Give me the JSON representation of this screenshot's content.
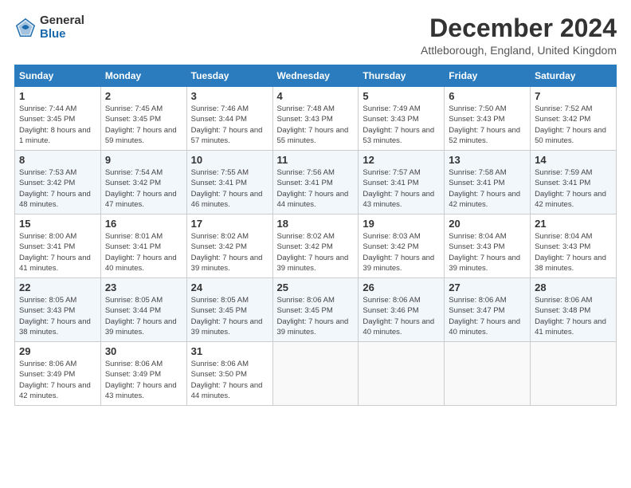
{
  "logo": {
    "general": "General",
    "blue": "Blue"
  },
  "header": {
    "month": "December 2024",
    "location": "Attleborough, England, United Kingdom"
  },
  "weekdays": [
    "Sunday",
    "Monday",
    "Tuesday",
    "Wednesday",
    "Thursday",
    "Friday",
    "Saturday"
  ],
  "weeks": [
    [
      {
        "day": "1",
        "sunrise": "Sunrise: 7:44 AM",
        "sunset": "Sunset: 3:45 PM",
        "daylight": "Daylight: 8 hours and 1 minute."
      },
      {
        "day": "2",
        "sunrise": "Sunrise: 7:45 AM",
        "sunset": "Sunset: 3:45 PM",
        "daylight": "Daylight: 7 hours and 59 minutes."
      },
      {
        "day": "3",
        "sunrise": "Sunrise: 7:46 AM",
        "sunset": "Sunset: 3:44 PM",
        "daylight": "Daylight: 7 hours and 57 minutes."
      },
      {
        "day": "4",
        "sunrise": "Sunrise: 7:48 AM",
        "sunset": "Sunset: 3:43 PM",
        "daylight": "Daylight: 7 hours and 55 minutes."
      },
      {
        "day": "5",
        "sunrise": "Sunrise: 7:49 AM",
        "sunset": "Sunset: 3:43 PM",
        "daylight": "Daylight: 7 hours and 53 minutes."
      },
      {
        "day": "6",
        "sunrise": "Sunrise: 7:50 AM",
        "sunset": "Sunset: 3:43 PM",
        "daylight": "Daylight: 7 hours and 52 minutes."
      },
      {
        "day": "7",
        "sunrise": "Sunrise: 7:52 AM",
        "sunset": "Sunset: 3:42 PM",
        "daylight": "Daylight: 7 hours and 50 minutes."
      }
    ],
    [
      {
        "day": "8",
        "sunrise": "Sunrise: 7:53 AM",
        "sunset": "Sunset: 3:42 PM",
        "daylight": "Daylight: 7 hours and 48 minutes."
      },
      {
        "day": "9",
        "sunrise": "Sunrise: 7:54 AM",
        "sunset": "Sunset: 3:42 PM",
        "daylight": "Daylight: 7 hours and 47 minutes."
      },
      {
        "day": "10",
        "sunrise": "Sunrise: 7:55 AM",
        "sunset": "Sunset: 3:41 PM",
        "daylight": "Daylight: 7 hours and 46 minutes."
      },
      {
        "day": "11",
        "sunrise": "Sunrise: 7:56 AM",
        "sunset": "Sunset: 3:41 PM",
        "daylight": "Daylight: 7 hours and 44 minutes."
      },
      {
        "day": "12",
        "sunrise": "Sunrise: 7:57 AM",
        "sunset": "Sunset: 3:41 PM",
        "daylight": "Daylight: 7 hours and 43 minutes."
      },
      {
        "day": "13",
        "sunrise": "Sunrise: 7:58 AM",
        "sunset": "Sunset: 3:41 PM",
        "daylight": "Daylight: 7 hours and 42 minutes."
      },
      {
        "day": "14",
        "sunrise": "Sunrise: 7:59 AM",
        "sunset": "Sunset: 3:41 PM",
        "daylight": "Daylight: 7 hours and 42 minutes."
      }
    ],
    [
      {
        "day": "15",
        "sunrise": "Sunrise: 8:00 AM",
        "sunset": "Sunset: 3:41 PM",
        "daylight": "Daylight: 7 hours and 41 minutes."
      },
      {
        "day": "16",
        "sunrise": "Sunrise: 8:01 AM",
        "sunset": "Sunset: 3:41 PM",
        "daylight": "Daylight: 7 hours and 40 minutes."
      },
      {
        "day": "17",
        "sunrise": "Sunrise: 8:02 AM",
        "sunset": "Sunset: 3:42 PM",
        "daylight": "Daylight: 7 hours and 39 minutes."
      },
      {
        "day": "18",
        "sunrise": "Sunrise: 8:02 AM",
        "sunset": "Sunset: 3:42 PM",
        "daylight": "Daylight: 7 hours and 39 minutes."
      },
      {
        "day": "19",
        "sunrise": "Sunrise: 8:03 AM",
        "sunset": "Sunset: 3:42 PM",
        "daylight": "Daylight: 7 hours and 39 minutes."
      },
      {
        "day": "20",
        "sunrise": "Sunrise: 8:04 AM",
        "sunset": "Sunset: 3:43 PM",
        "daylight": "Daylight: 7 hours and 39 minutes."
      },
      {
        "day": "21",
        "sunrise": "Sunrise: 8:04 AM",
        "sunset": "Sunset: 3:43 PM",
        "daylight": "Daylight: 7 hours and 38 minutes."
      }
    ],
    [
      {
        "day": "22",
        "sunrise": "Sunrise: 8:05 AM",
        "sunset": "Sunset: 3:43 PM",
        "daylight": "Daylight: 7 hours and 38 minutes."
      },
      {
        "day": "23",
        "sunrise": "Sunrise: 8:05 AM",
        "sunset": "Sunset: 3:44 PM",
        "daylight": "Daylight: 7 hours and 39 minutes."
      },
      {
        "day": "24",
        "sunrise": "Sunrise: 8:05 AM",
        "sunset": "Sunset: 3:45 PM",
        "daylight": "Daylight: 7 hours and 39 minutes."
      },
      {
        "day": "25",
        "sunrise": "Sunrise: 8:06 AM",
        "sunset": "Sunset: 3:45 PM",
        "daylight": "Daylight: 7 hours and 39 minutes."
      },
      {
        "day": "26",
        "sunrise": "Sunrise: 8:06 AM",
        "sunset": "Sunset: 3:46 PM",
        "daylight": "Daylight: 7 hours and 40 minutes."
      },
      {
        "day": "27",
        "sunrise": "Sunrise: 8:06 AM",
        "sunset": "Sunset: 3:47 PM",
        "daylight": "Daylight: 7 hours and 40 minutes."
      },
      {
        "day": "28",
        "sunrise": "Sunrise: 8:06 AM",
        "sunset": "Sunset: 3:48 PM",
        "daylight": "Daylight: 7 hours and 41 minutes."
      }
    ],
    [
      {
        "day": "29",
        "sunrise": "Sunrise: 8:06 AM",
        "sunset": "Sunset: 3:49 PM",
        "daylight": "Daylight: 7 hours and 42 minutes."
      },
      {
        "day": "30",
        "sunrise": "Sunrise: 8:06 AM",
        "sunset": "Sunset: 3:49 PM",
        "daylight": "Daylight: 7 hours and 43 minutes."
      },
      {
        "day": "31",
        "sunrise": "Sunrise: 8:06 AM",
        "sunset": "Sunset: 3:50 PM",
        "daylight": "Daylight: 7 hours and 44 minutes."
      },
      null,
      null,
      null,
      null
    ]
  ]
}
